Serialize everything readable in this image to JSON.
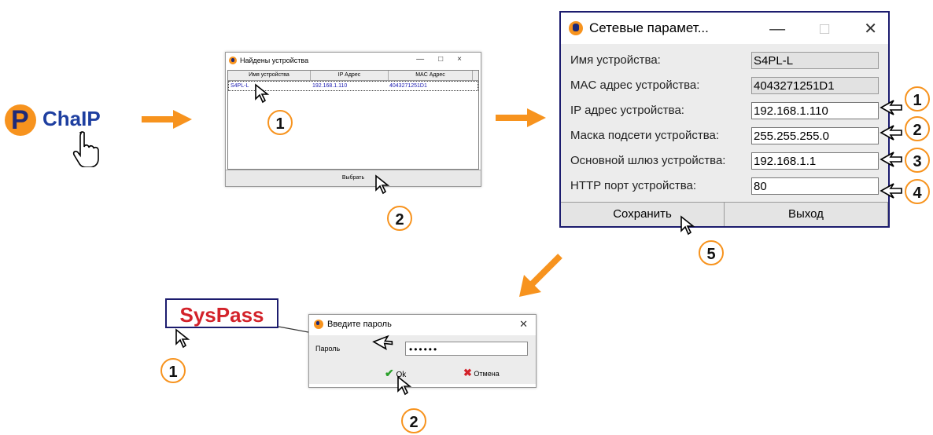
{
  "logo": {
    "text": "ChaIP",
    "letter": "P"
  },
  "found_window": {
    "title": "Найдены устройства",
    "columns": [
      "Имя устройства",
      "IP Адрес",
      "MAC Адрес"
    ],
    "rows": [
      {
        "name": "S4PL-L",
        "ip": "192.168.1.110",
        "mac": "4043271251D1"
      }
    ],
    "select_label": "Выбрать"
  },
  "net_window": {
    "title": "Сетевые парамет...",
    "fields": [
      {
        "label": "Имя устройства:",
        "value": "S4PL-L"
      },
      {
        "label": "MAC адрес устройства:",
        "value": "4043271251D1"
      },
      {
        "label": "IP адрес устройства:",
        "value": "192.168.1.110"
      },
      {
        "label": "Маска подсети устройства:",
        "value": "255.255.255.0"
      },
      {
        "label": "Основной шлюз устройства:",
        "value": "192.168.1.1"
      },
      {
        "label": "HTTP порт устройства:",
        "value": "80"
      }
    ],
    "save_label": "Сохранить",
    "exit_label": "Выход"
  },
  "password_window": {
    "title": "Введите пароль",
    "label": "Пароль",
    "value": "••••••",
    "ok_label": "Ok",
    "cancel_label": "Отмена"
  },
  "syspass": "SysPass",
  "badges": {
    "b1": "1",
    "b2": "2",
    "r1": "1",
    "r2": "2",
    "r3": "3",
    "r4": "4",
    "r5": "5",
    "p1": "1",
    "p2": "2"
  },
  "colors": {
    "accent": "#f7931e",
    "brand_blue": "#1e3fa0",
    "syspass_red": "#d3222a",
    "frame_navy": "#1c1c6e"
  }
}
